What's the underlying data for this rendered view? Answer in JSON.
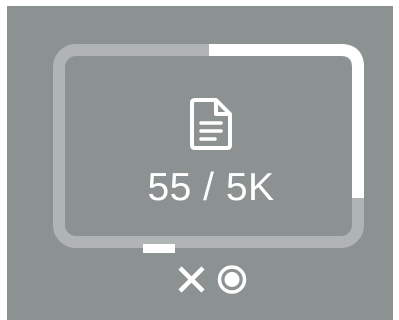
{
  "status": {
    "count_text": "55 / 5K",
    "progress_fraction": 0.44
  },
  "icons": {
    "main": "file-icon",
    "cancel": "close-icon",
    "record": "record-icon"
  },
  "colors": {
    "panel": "#8c9191",
    "track": "#b1b4b4",
    "progress": "#ffffff",
    "inner": "#8c9191"
  }
}
